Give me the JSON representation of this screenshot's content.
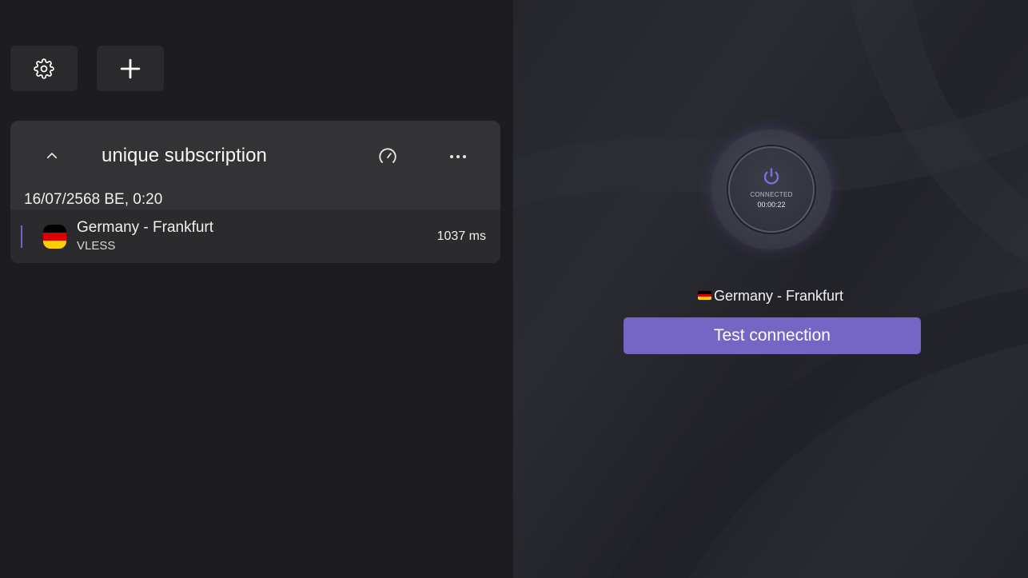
{
  "toolbar": {
    "settings_icon": "gear-icon",
    "add_icon": "plus-icon"
  },
  "subscription": {
    "title": "unique subscription",
    "collapse_icon": "chevron-up-icon",
    "speedtest_icon": "speedometer-icon",
    "more_icon": "more-horizontal-icon",
    "updated_at": "16/07/2568 BE, 0:20",
    "servers": [
      {
        "name": "Germany - Frankfurt",
        "protocol": "VLESS",
        "ping": "1037 ms",
        "flag_colors": [
          "#000000",
          "#dd0000",
          "#ffce00"
        ],
        "selected": true
      }
    ]
  },
  "connection": {
    "power_icon": "power-icon",
    "status": "CONNECTED",
    "timer": "00:00:22",
    "location": "Germany - Frankfurt",
    "test_button_label": "Test connection",
    "accent_color": "#7565c4"
  }
}
